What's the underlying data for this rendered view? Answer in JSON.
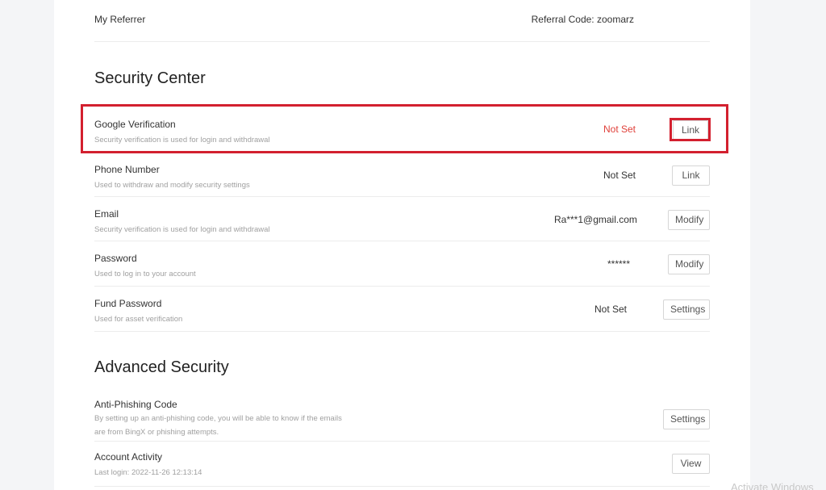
{
  "referrer": {
    "label": "My Referrer",
    "code": "Referral Code: zoomarz"
  },
  "security_center": {
    "title": "Security Center",
    "rows": [
      {
        "title": "Google Verification",
        "desc": "Security verification is used for login and withdrawal",
        "status": "Not Set",
        "button": "Link"
      },
      {
        "title": "Phone Number",
        "desc": "Used to withdraw and modify security settings",
        "status": "Not Set",
        "button": "Link"
      },
      {
        "title": "Email",
        "desc": "Security verification is used for login and withdrawal",
        "status": "Ra***1@gmail.com",
        "button": "Modify"
      },
      {
        "title": "Password",
        "desc": "Used to log in to your account",
        "status": "******",
        "button": "Modify"
      },
      {
        "title": "Fund Password",
        "desc": "Used for asset verification",
        "status": "Not Set",
        "button": "Settings"
      }
    ]
  },
  "advanced_security": {
    "title": "Advanced Security",
    "rows": [
      {
        "title": "Anti-Phishing Code",
        "desc_line1": "By setting up an anti-phishing code, you will be able to know if the emails",
        "desc_line2": "are from BingX or phishing attempts.",
        "button": "Settings"
      },
      {
        "title": "Account Activity",
        "desc": "Last login: 2022-11-26 12:13:14",
        "button": "View"
      }
    ]
  },
  "watermark": "Activate Windows",
  "colors": {
    "highlight": "#d3202f",
    "not_set_red": "#e0403a"
  }
}
